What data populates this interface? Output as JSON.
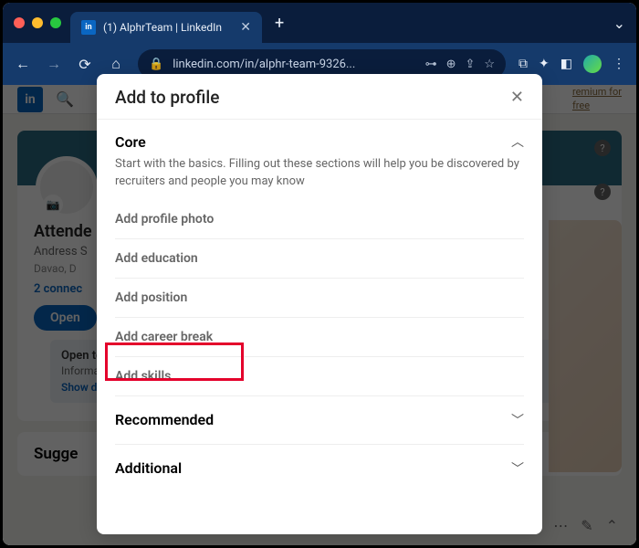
{
  "browser": {
    "tab_title": "(1) AlphrTeam | LinkedIn",
    "url": "linkedin.com/in/alphr-team-9326..."
  },
  "header": {
    "logo_text": "in",
    "premium_line1": "remium for",
    "premium_line2": "free"
  },
  "profile": {
    "name": "Attende",
    "subtitle": "Andress S",
    "location": "Davao, D",
    "connections": "2 connec",
    "open_button": "Open",
    "open_card": {
      "title": "Open to",
      "sub": "Informa",
      "link": "Show d"
    },
    "suggested": "Sugge"
  },
  "modal": {
    "title": "Add to profile",
    "sections": {
      "core": {
        "title": "Core",
        "desc": "Start with the basics. Filling out these sections will help you be discovered by recruiters and people you may know",
        "items": [
          "Add profile photo",
          "Add education",
          "Add position",
          "Add career break",
          "Add skills"
        ]
      },
      "recommended": {
        "title": "Recommended"
      },
      "additional": {
        "title": "Additional"
      }
    }
  }
}
